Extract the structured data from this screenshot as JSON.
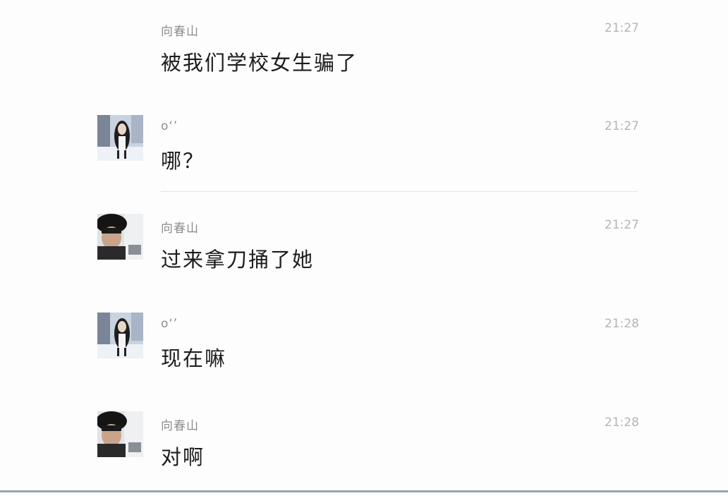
{
  "messages": [
    {
      "sender": "向春山",
      "time": "21:27",
      "text": "被我们学校女生骗了",
      "avatar": "none"
    },
    {
      "sender": "o‘’",
      "time": "21:27",
      "text": "哪？",
      "avatar": "girl-photo"
    },
    {
      "sender": "向春山",
      "time": "21:27",
      "text": "过来拿刀捅了她",
      "avatar": "guy-photo"
    },
    {
      "sender": "o‘’",
      "time": "21:28",
      "text": "现在嘛",
      "avatar": "girl-photo"
    },
    {
      "sender": "向春山",
      "time": "21:28",
      "text": "对啊",
      "avatar": "guy-photo"
    }
  ]
}
